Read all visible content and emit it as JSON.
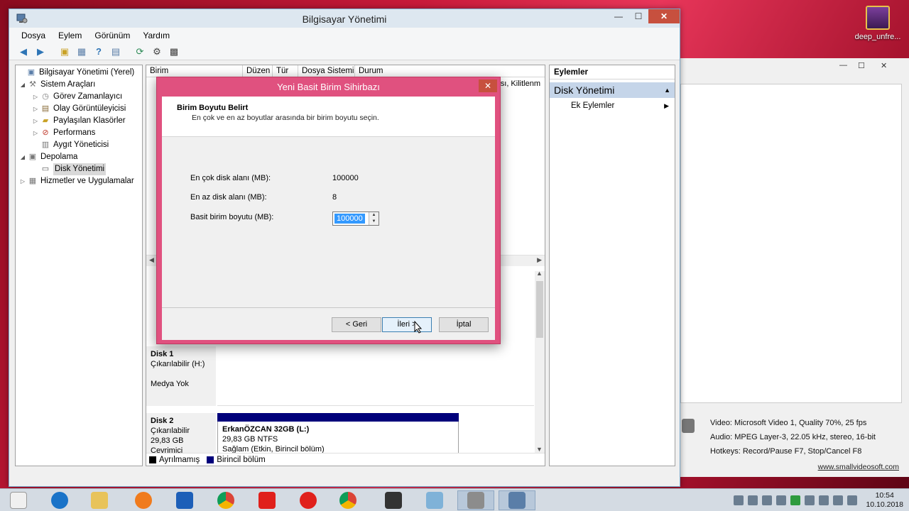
{
  "desktop": {
    "icon_label": "deep_unfre..."
  },
  "main_window": {
    "title": "Bilgisayar Yönetimi",
    "menu": [
      "Dosya",
      "Eylem",
      "Görünüm",
      "Yardım"
    ]
  },
  "tree": {
    "items": [
      {
        "label": "Bilgisayar Yönetimi (Yerel)"
      },
      {
        "label": "Sistem Araçları"
      },
      {
        "label": "Görev Zamanlayıcı"
      },
      {
        "label": "Olay Görüntüleyicisi"
      },
      {
        "label": "Paylaşılan Klasörler"
      },
      {
        "label": "Performans"
      },
      {
        "label": "Aygıt Yöneticisi"
      },
      {
        "label": "Depolama"
      },
      {
        "label": "Disk Yönetimi"
      },
      {
        "label": "Hizmetler ve Uygulamalar"
      }
    ]
  },
  "columns": [
    "Birim",
    "Düzen",
    "Tür",
    "Dosya Sistemi",
    "Durum"
  ],
  "vol_list_partial": "ası, Kilitlenm",
  "disks": [
    {
      "name": "Disk 1",
      "type": "Çıkarılabilir (H:)",
      "media": "Medya Yok"
    },
    {
      "name": "Disk 2",
      "type": "Çıkarılabilir",
      "size": "29,83 GB",
      "status": "Çevrimiçi",
      "partition": {
        "name": "ErkanÖZCAN 32GB  (L:)",
        "size": "29,83 GB NTFS",
        "status": "Sağlam (Etkin, Birincil bölüm)"
      }
    }
  ],
  "legend": [
    {
      "label": "Ayrılmamış",
      "color": "#000000"
    },
    {
      "label": "Birincil bölüm",
      "color": "#00007b"
    }
  ],
  "actions": {
    "header": "Eylemler",
    "section": "Disk Yönetimi",
    "item": "Ek Eylemler"
  },
  "wizard": {
    "title": "Yeni Basit Birim Sihirbazı",
    "header_title": "Birim Boyutu Belirt",
    "header_sub": "En çok ve en az boyutlar arasında bir birim boyutu seçin.",
    "max_label": "En çok disk alanı (MB):",
    "max_value": "100000",
    "min_label": "En az disk alanı (MB):",
    "min_value": "8",
    "size_label": "Basit birim boyutu (MB):",
    "size_value": "100000",
    "back_label": "< Geri",
    "next_label": "İleri >",
    "cancel_label": "İptal"
  },
  "second_window": {
    "info_lines": [
      "Video: Microsoft Video 1, Quality 70%, 25 fps",
      "Audio: MPEG Layer-3, 22.05 kHz, stereo, 16-bit",
      "Hotkeys: Record/Pause F7, Stop/Cancel F8"
    ],
    "link": "www.smallvideosoft.com"
  },
  "taskbar": {
    "time": "10:54",
    "date": "10.10.2018"
  }
}
